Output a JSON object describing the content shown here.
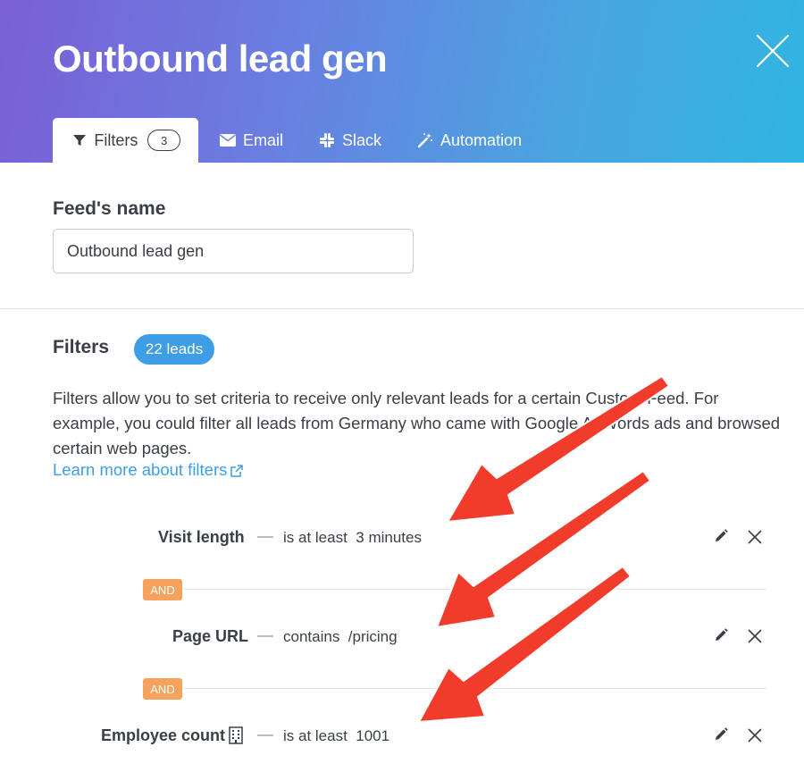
{
  "header": {
    "title": "Outbound lead gen",
    "close_icon": "close-icon"
  },
  "tabs": [
    {
      "label": "Filters",
      "icon": "filter-icon",
      "count": "3",
      "active": true
    },
    {
      "label": "Email",
      "icon": "envelope-icon"
    },
    {
      "label": "Slack",
      "icon": "slack-icon"
    },
    {
      "label": "Automation",
      "icon": "magic-wand-icon"
    }
  ],
  "feed_name": {
    "label": "Feed's name",
    "value": "Outbound lead gen"
  },
  "filters_section": {
    "heading": "Filters",
    "leads_badge": "22 leads",
    "description": "Filters allow you to set criteria to receive only relevant leads for a certain Custom Feed. For example, you could filter all leads from Germany who came with Google AdWords ads and browsed certain web pages.",
    "learn_more": "Learn more about filters"
  },
  "filters": [
    {
      "field": "Visit length",
      "operator": "is at least",
      "value": "3 minutes"
    },
    {
      "field": "Page URL",
      "operator": "contains",
      "value": "/pricing"
    },
    {
      "field": "Employee count",
      "operator": "is at least",
      "value": "1001",
      "icon": "building-icon"
    }
  ],
  "connector": "AND",
  "colors": {
    "accent": "#3d9ee6",
    "and_badge": "#f6a25d",
    "arrow": "#f23c2b"
  }
}
